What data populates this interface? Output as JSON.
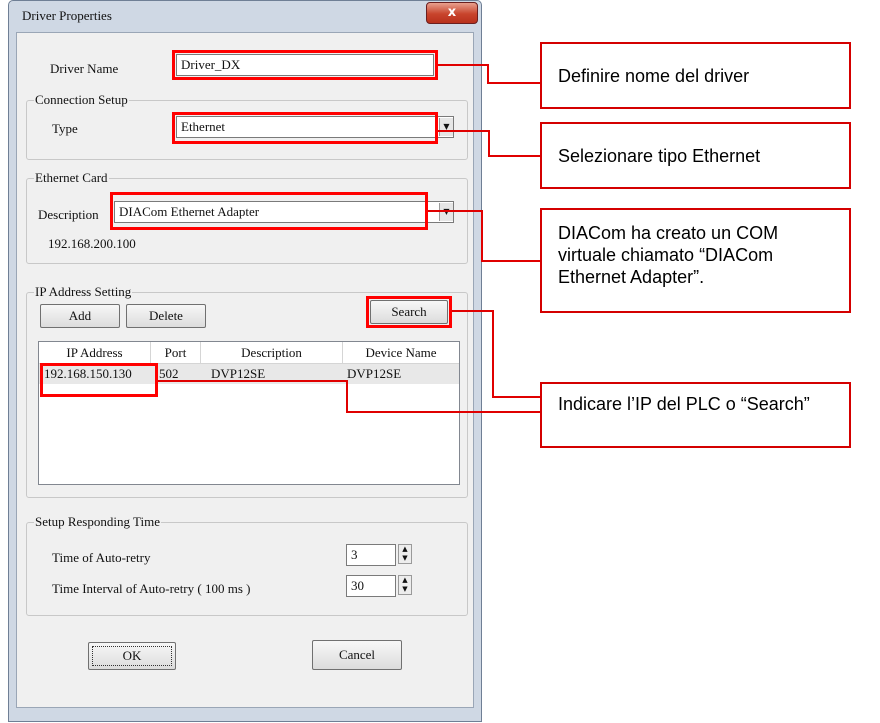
{
  "window": {
    "title": "Driver Properties",
    "close_glyph": "x"
  },
  "driver": {
    "name_label": "Driver Name",
    "name_value": "Driver_DX"
  },
  "connection": {
    "legend": "Connection Setup",
    "type_label": "Type",
    "type_value": "Ethernet"
  },
  "ethernet_card": {
    "legend": "Ethernet Card",
    "description_label": "Description",
    "description_value": "DIACom Ethernet Adapter",
    "ip": "192.168.200.100"
  },
  "ip_setting": {
    "legend": "IP Address Setting",
    "add_label": "Add",
    "delete_label": "Delete",
    "search_label": "Search",
    "columns": [
      "IP Address",
      "Port",
      "Description",
      "Device Name"
    ],
    "rows": [
      {
        "ip": "192.168.150.130",
        "port": "502",
        "description": "DVP12SE",
        "device": "DVP12SE"
      }
    ]
  },
  "responding": {
    "legend": "Setup Responding Time",
    "retry_label": "Time of Auto-retry",
    "retry_value": "3",
    "interval_label": "Time Interval of Auto-retry ( 100 ms )",
    "interval_value": "30"
  },
  "buttons": {
    "ok_label": "OK",
    "cancel_label": "Cancel"
  },
  "callouts": {
    "driver_name": "Definire nome del driver",
    "type": "Selezionare tipo Ethernet",
    "adapter": "DIACom ha creato un COM virtuale chiamato “DIACom Ethernet Adapter”.",
    "ip": "Indicare l’IP del PLC o “Search”"
  },
  "colors": {
    "highlight": "#ff0000",
    "dialog_face": "#f0f0f0",
    "frame": "#cfd8e4"
  },
  "icons": {
    "dropdown": "triangle-down",
    "spin_up": "triangle-up",
    "spin_down": "triangle-down"
  }
}
